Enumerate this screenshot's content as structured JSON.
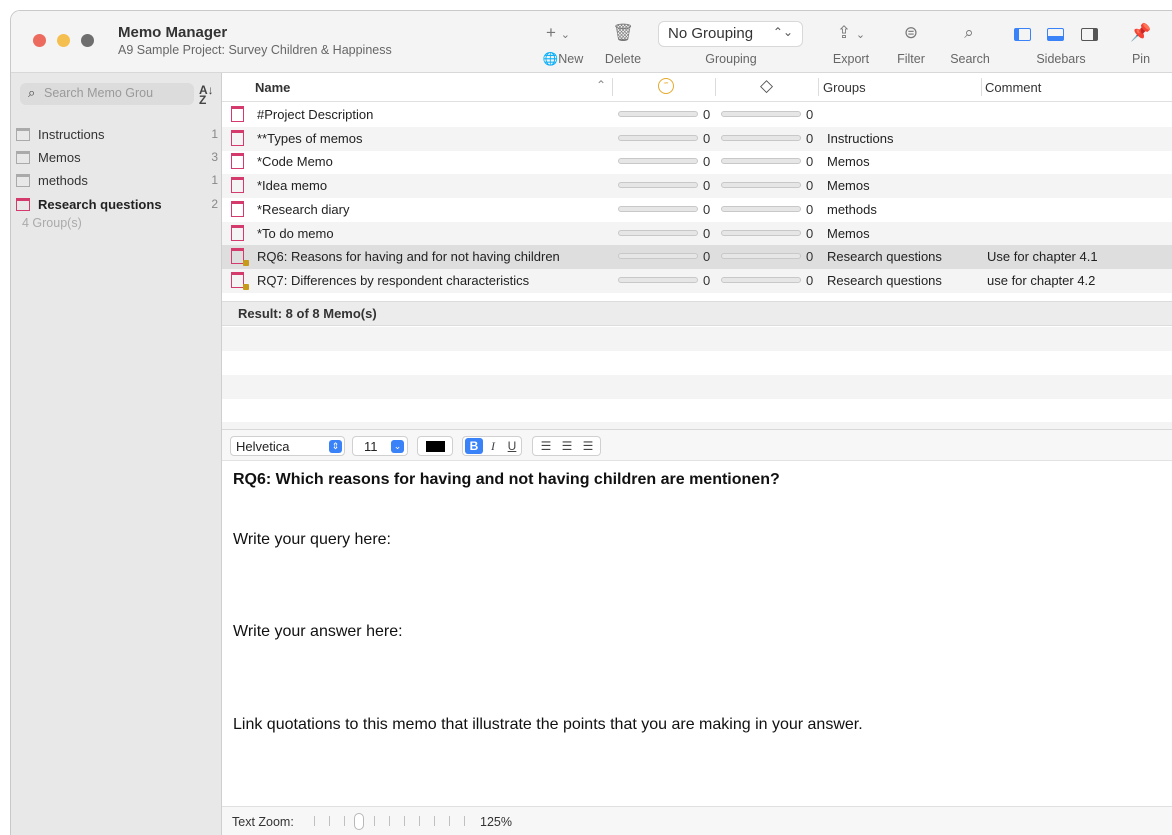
{
  "app": {
    "title": "Memo Manager",
    "subtitle": "A9 Sample Project: Survey Children & Happiness"
  },
  "toolbar": {
    "new_label": "New",
    "delete_label": "Delete",
    "grouping_label": "Grouping",
    "grouping_value": "No Grouping",
    "export_label": "Export",
    "filter_label": "Filter",
    "search_label": "Search",
    "sidebars_label": "Sidebars",
    "pin_label": "Pin"
  },
  "sidebar": {
    "search_placeholder": "Search Memo Grou",
    "groups": [
      {
        "label": "Instructions",
        "count": "1"
      },
      {
        "label": "Memos",
        "count": "3"
      },
      {
        "label": "methods",
        "count": "1"
      },
      {
        "label": "Research questions",
        "count": "2"
      }
    ],
    "group_count": "4 Group(s)"
  },
  "table": {
    "headers": {
      "name": "Name",
      "groups": "Groups",
      "comment": "Comment"
    },
    "rows": [
      {
        "name": "#Project Description",
        "q": "0",
        "l": "0",
        "group": "",
        "comment": ""
      },
      {
        "name": "**Types of memos",
        "q": "0",
        "l": "0",
        "group": "Instructions",
        "comment": ""
      },
      {
        "name": "*Code Memo",
        "q": "0",
        "l": "0",
        "group": "Memos",
        "comment": ""
      },
      {
        "name": "*Idea memo",
        "q": "0",
        "l": "0",
        "group": "Memos",
        "comment": ""
      },
      {
        "name": "*Research diary",
        "q": "0",
        "l": "0",
        "group": "methods",
        "comment": ""
      },
      {
        "name": "*To do memo",
        "q": "0",
        "l": "0",
        "group": "Memos",
        "comment": ""
      },
      {
        "name": "RQ6: Reasons for having and for not having children",
        "q": "0",
        "l": "0",
        "group": "Research questions",
        "comment": "Use for chapter 4.1"
      },
      {
        "name": "RQ7: Differences by respondent characteristics",
        "q": "0",
        "l": "0",
        "group": "Research questions",
        "comment": "use for chapter 4.2"
      }
    ],
    "result": "Result: 8 of 8 Memo(s)"
  },
  "format": {
    "font": "Helvetica",
    "size": "11",
    "bold": "B",
    "italic": "I",
    "underline": "U"
  },
  "editor": {
    "heading": "RQ6: Which reasons for having and not having children are mentionen?",
    "line1": "Write your query here:",
    "line2": "Write your answer here:",
    "line3": "Link quotations to this memo that illustrate the points that you are making in your answer."
  },
  "zoom": {
    "label": "Text Zoom:",
    "value": "125%",
    "level": 0.3
  },
  "colors": {
    "accent": "#3a82f7",
    "memo_icon": "#d43a6b",
    "close": "#ec6a5e",
    "minimize": "#f4bf4f",
    "zoom_btn": "#6e6e6e"
  }
}
